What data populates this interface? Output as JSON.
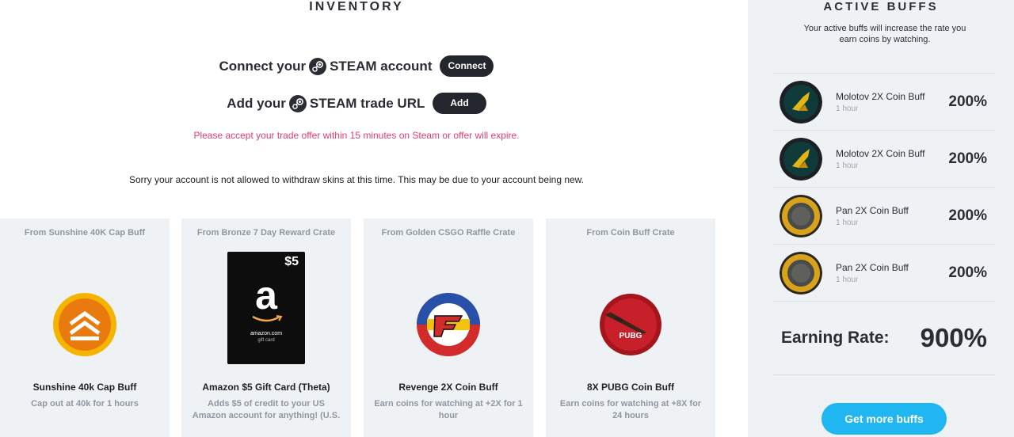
{
  "inventory": {
    "title": "INVENTORY",
    "connect": {
      "prefix": "Connect your",
      "suffix": "STEAM account",
      "button": "Connect"
    },
    "trade": {
      "prefix": "Add your",
      "suffix": "STEAM trade URL",
      "button": "Add"
    },
    "warning": "Please accept your trade offer within 15 minutes on Steam or offer will expire.",
    "notice": "Sorry your account is not allowed to withdraw skins at this time. This may be due to your account being new."
  },
  "cards": [
    {
      "from": "From Sunshine 40K Cap Buff",
      "name": "Sunshine 40k Cap Buff",
      "desc": "Cap out at 40k for 1 hours",
      "icon": "sunshine-buff-icon"
    },
    {
      "from": "From Bronze 7 Day Reward Crate",
      "name": "Amazon $5 Gift Card (Theta)",
      "desc": "Adds $5 of credit to your US Amazon account for anything! (U.S.",
      "icon": "amazon-gift-card",
      "card_amount": "$5",
      "card_brand": "amazon.com",
      "card_sub": "gift card"
    },
    {
      "from": "From Golden CSGO Raffle Crate",
      "name": "Revenge 2X Coin Buff",
      "desc": "Earn coins for watching at +2X for 1 hour",
      "icon": "faze-revenge-icon"
    },
    {
      "from": "From Coin Buff Crate",
      "name": "8X PUBG Coin Buff",
      "desc": "Earn coins for watching at +8X for 24 hours",
      "icon": "pubg-icon",
      "badge_text": "PUBG"
    }
  ],
  "sidebar": {
    "title": "ACTIVE BUFFS",
    "subtitle": "Your active buffs will increase the rate you earn coins by watching.",
    "buffs": [
      {
        "name": "Molotov 2X Coin Buff",
        "duration": "1 hour",
        "percent": "200%",
        "icon": "molotov-icon"
      },
      {
        "name": "Molotov 2X Coin Buff",
        "duration": "1 hour",
        "percent": "200%",
        "icon": "molotov-icon"
      },
      {
        "name": "Pan 2X Coin Buff",
        "duration": "1 hour",
        "percent": "200%",
        "icon": "pan-icon"
      },
      {
        "name": "Pan 2X Coin Buff",
        "duration": "1 hour",
        "percent": "200%",
        "icon": "pan-icon"
      }
    ],
    "earning_label": "Earning Rate:",
    "earning_value": "900%",
    "more_button": "Get more buffs"
  },
  "colors": {
    "accent": "#1fb6f1",
    "warning": "#e23c6b",
    "dark_pill": "#23272d",
    "panel": "#eff2f5"
  }
}
